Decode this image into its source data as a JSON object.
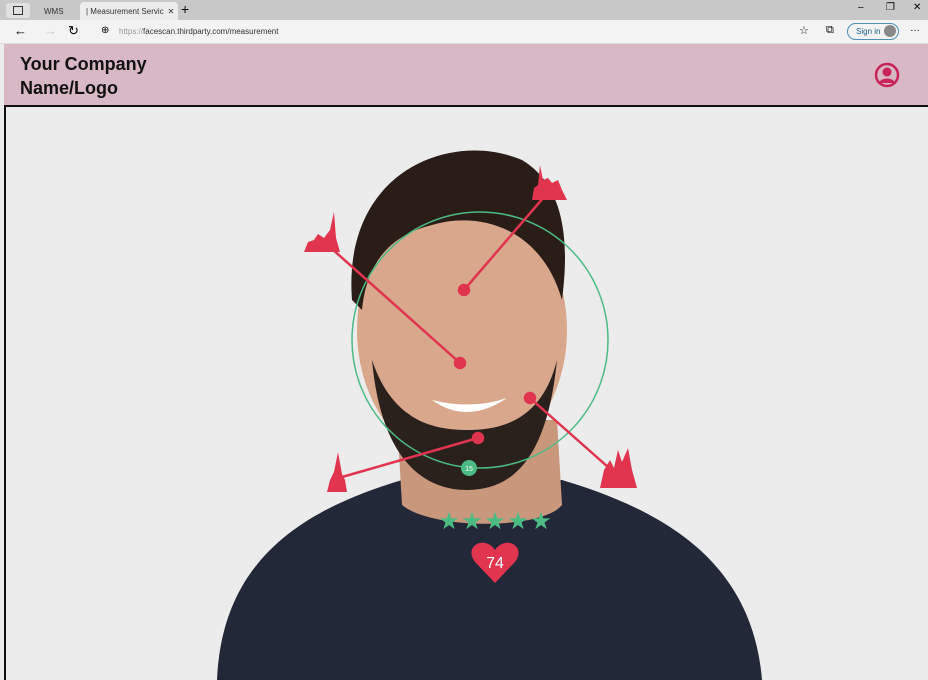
{
  "browser": {
    "tabs": [
      {
        "label": "WMS"
      },
      {
        "label": "| Measurement Servic"
      }
    ],
    "url_prefix": "https://",
    "url": "facescan.thirdparty.com/measurement",
    "sign_in": "Sign in"
  },
  "header": {
    "title_line1": "Your Company",
    "title_line2": "Name/Logo",
    "accent": "#c8245a"
  },
  "overlay": {
    "circle_label": "15",
    "rating_stars": 5,
    "heart_score": "74",
    "line_color": "#e0344f",
    "circle_color": "#4cbb84"
  }
}
